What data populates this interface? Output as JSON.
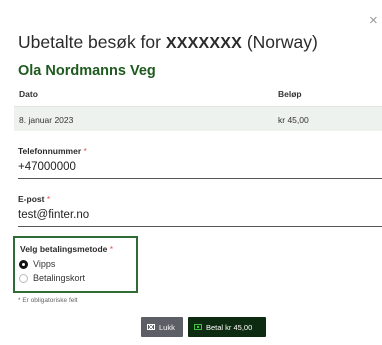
{
  "dialog": {
    "title_prefix": "Ubetalte besøk for ",
    "title_masked": "XXXXXXX",
    "title_suffix": " (Norway)",
    "close_glyph": "×",
    "venue": "Ola Nordmanns Veg"
  },
  "table": {
    "headers": [
      "Dato",
      "Beløp"
    ],
    "rows": [
      {
        "date": "8. januar 2023",
        "amount": "kr 45,00"
      }
    ]
  },
  "phone": {
    "label": "Telefonnummer",
    "required_mark": "*",
    "value": "+47000000"
  },
  "email": {
    "label": "E-post",
    "required_mark": "*",
    "value": "test@finter.no"
  },
  "payment": {
    "label": "Velg betalingsmetode",
    "required_mark": "*",
    "options": [
      {
        "label": "Vipps",
        "selected": true
      },
      {
        "label": "Betalingskort",
        "selected": false
      }
    ]
  },
  "footer": {
    "required_note": "* Er obligatoriske felt",
    "close_label": "Lukk",
    "pay_label": "Betal kr 45,00"
  },
  "colors": {
    "accent": "#2e6b35",
    "pay_button": "#0d2b10",
    "close_button": "#5d5f66",
    "required": "#e2574c"
  },
  "icons": {
    "close": "close-icon",
    "close_button_icon": "close-x-box-icon",
    "pay_button_icon": "payment-card-icon"
  }
}
